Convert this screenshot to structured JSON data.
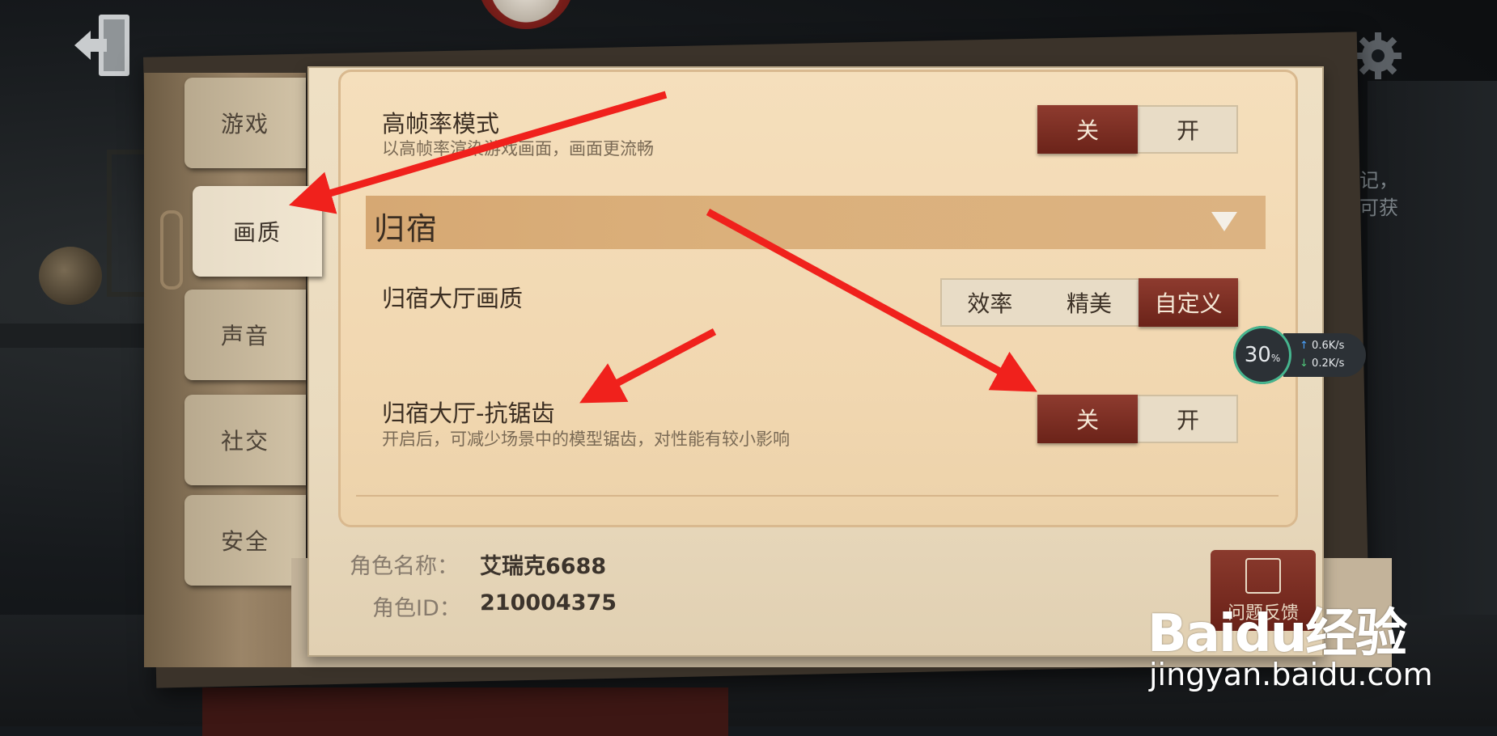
{
  "tabs": [
    {
      "label": "游戏",
      "active": false
    },
    {
      "label": "画质",
      "active": true
    },
    {
      "label": "声音",
      "active": false
    },
    {
      "label": "社交",
      "active": false
    },
    {
      "label": "安全",
      "active": false
    }
  ],
  "settings": {
    "high_fps": {
      "title": "高帧率模式",
      "desc": "以高帧率渲染游戏画面，画面更流畅",
      "options": [
        "关",
        "开"
      ],
      "selected": "关"
    },
    "section": {
      "title": "归宿"
    },
    "lobby_quality": {
      "title": "归宿大厅画质",
      "options": [
        "效率",
        "精美",
        "自定义"
      ],
      "selected": "自定义"
    },
    "lobby_aa": {
      "title": "归宿大厅-抗锯齿",
      "desc": "开启后，可减少场景中的模型锯齿，对性能有较小影响",
      "options": [
        "关",
        "开"
      ],
      "selected": "关"
    }
  },
  "player": {
    "name_label": "角色名称：",
    "name_value": "艾瑞克6688",
    "id_label": "角色ID：",
    "id_value": "210004375"
  },
  "feedback": {
    "label": "问题反馈"
  },
  "perf": {
    "percent": "30",
    "percent_unit": "%",
    "up": "0.6",
    "down": "0.2",
    "rate_unit": "K/s"
  },
  "side_text": [
    "记，",
    "可获"
  ],
  "watermark": {
    "logo": "Baidu经验",
    "url": "jingyan.baidu.com"
  },
  "colors": {
    "accent": "#7a2a20",
    "arrow": "#f0211c",
    "paper": "#f1d7b0"
  }
}
